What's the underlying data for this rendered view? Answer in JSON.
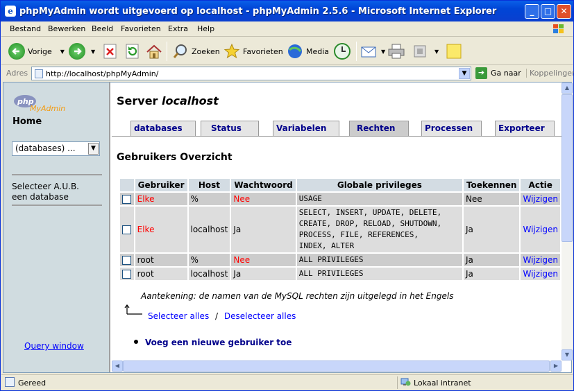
{
  "window": {
    "title": "phpMyAdmin wordt uitgevoerd op localhost - phpMyAdmin 2.5.6 - Microsoft Internet Explorer"
  },
  "menu": [
    "Bestand",
    "Bewerken",
    "Beeld",
    "Favorieten",
    "Extra",
    "Help"
  ],
  "toolbar": {
    "back": "Vorige",
    "search": "Zoeken",
    "favorites": "Favorieten",
    "media": "Media"
  },
  "address": {
    "label": "Adres",
    "url": "http://localhost/phpMyAdmin/",
    "go": "Ga naar",
    "links": "Koppelingen"
  },
  "left": {
    "logo_php": "php",
    "logo_mya": "MyAdmin",
    "home": "Home",
    "db_select": "(databases) ...",
    "select_db": "Selecteer A.U.B. een database",
    "query_window": "Query window"
  },
  "server": {
    "prefix": "Server",
    "name": "localhost"
  },
  "tabs": [
    "databases",
    "Status",
    "Variabelen",
    "Rechten",
    "Processen",
    "Exporteer"
  ],
  "active_tab": "Rechten",
  "users": {
    "title": "Gebruikers Overzicht",
    "columns": [
      "Gebruiker",
      "Host",
      "Wachtwoord",
      "Globale privileges",
      "Toekennen",
      "Actie"
    ],
    "rows": [
      {
        "user": "Elke",
        "host": "%",
        "password": "Nee",
        "privileges": "USAGE",
        "grant": "Nee",
        "action": "Wijzigen"
      },
      {
        "user": "Elke",
        "host": "localhost",
        "password": "Ja",
        "privileges": "SELECT, INSERT, UPDATE, DELETE,\nCREATE, DROP, RELOAD, SHUTDOWN,\nPROCESS, FILE, REFERENCES,\nINDEX, ALTER",
        "grant": "Ja",
        "action": "Wijzigen"
      },
      {
        "user": "root",
        "host": "%",
        "password": "Nee",
        "privileges": "ALL PRIVILEGES",
        "grant": "Ja",
        "action": "Wijzigen"
      },
      {
        "user": "root",
        "host": "localhost",
        "password": "Ja",
        "privileges": "ALL PRIVILEGES",
        "grant": "Ja",
        "action": "Wijzigen"
      }
    ],
    "note": "Aantekening: de namen van de MySQL rechten zijn uitgelegd in het Engels",
    "select_all": "Selecteer alles",
    "separator": "/",
    "deselect_all": "Deselecteer alles",
    "add_user": "Voeg een nieuwe gebruiker toe"
  },
  "status": {
    "text": "Gereed",
    "zone": "Lokaal intranet"
  },
  "colors": {
    "red": "#ff0000",
    "link": "#0000ff",
    "tab_text": "#00008b"
  }
}
